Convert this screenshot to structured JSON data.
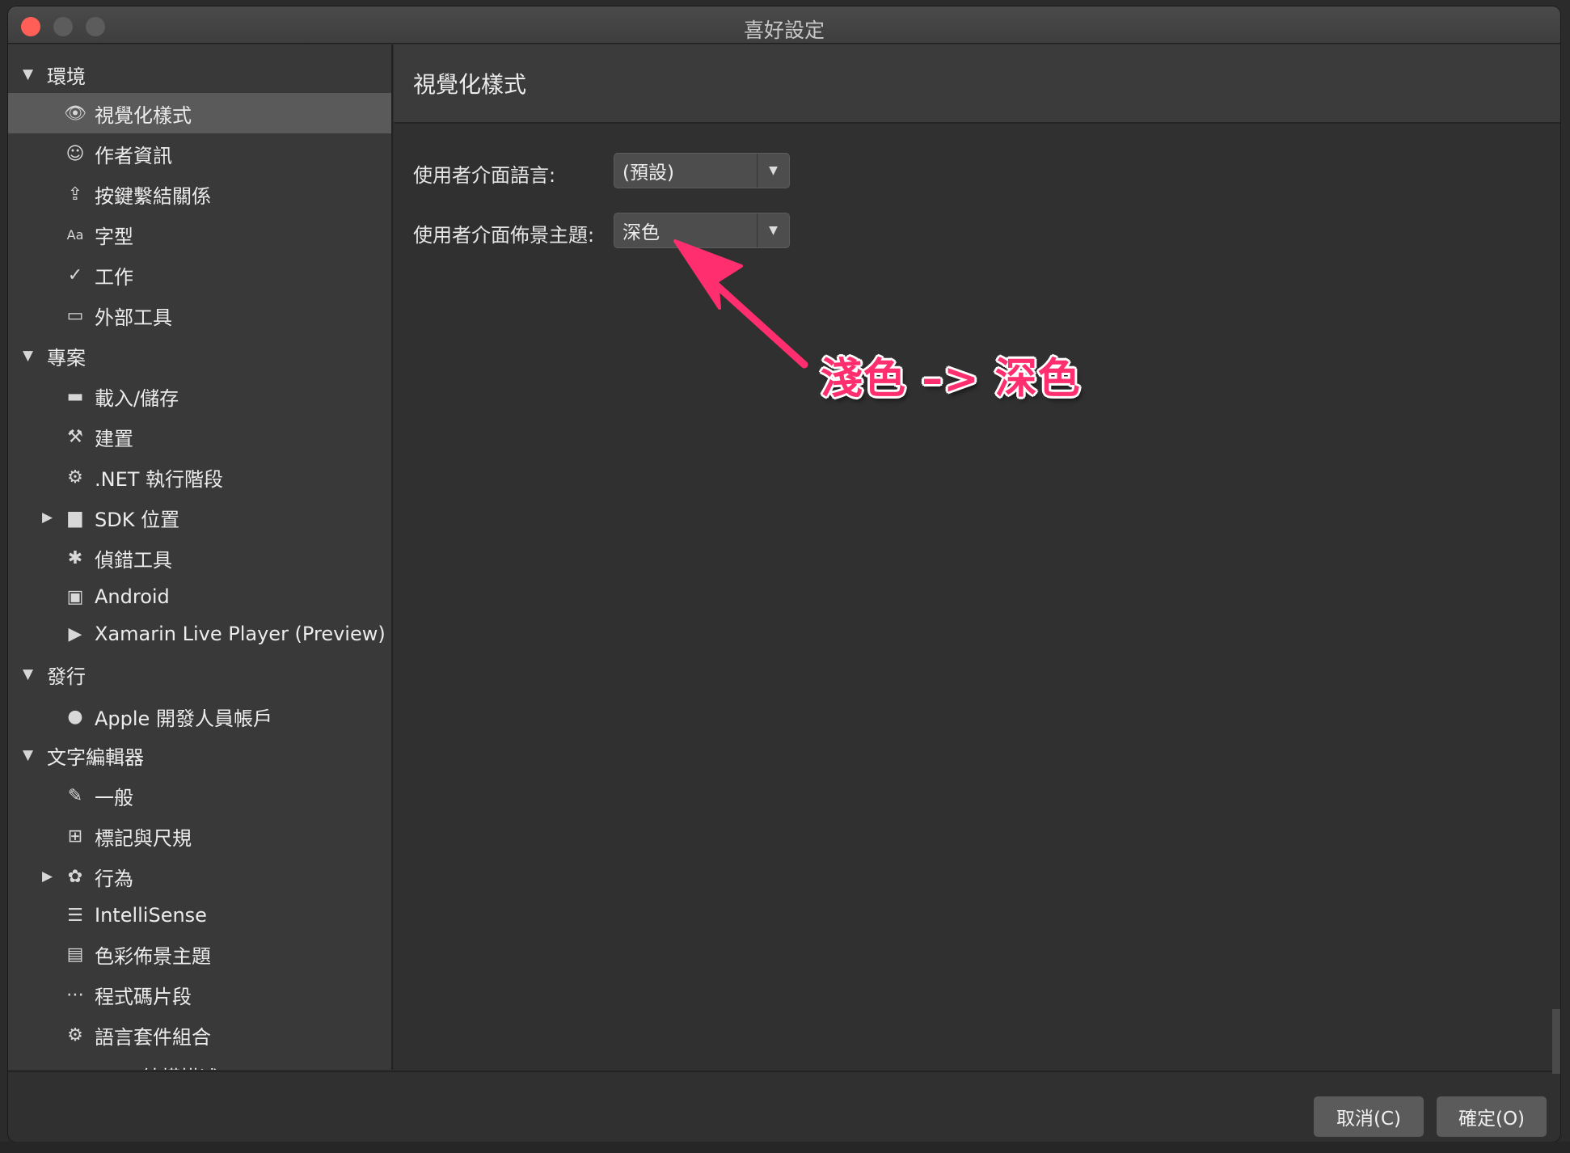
{
  "window": {
    "title": "喜好設定"
  },
  "sidebar": {
    "items": [
      {
        "type": "section",
        "label": "環境",
        "expanded": true,
        "icon": "triangle-down"
      },
      {
        "type": "item",
        "label": "視覺化樣式",
        "icon": "eye-icon",
        "selected": true
      },
      {
        "type": "item",
        "label": "作者資訊",
        "icon": "smiley-icon"
      },
      {
        "type": "item",
        "label": "按鍵繫結關係",
        "icon": "keyboard-icon"
      },
      {
        "type": "item",
        "label": "字型",
        "icon": "font-icon",
        "glyph": "Aa"
      },
      {
        "type": "item",
        "label": "工作",
        "icon": "checkmark-icon"
      },
      {
        "type": "item",
        "label": "外部工具",
        "icon": "terminal-icon"
      },
      {
        "type": "section",
        "label": "專案",
        "expanded": true,
        "icon": "triangle-down"
      },
      {
        "type": "item",
        "label": "載入/儲存",
        "icon": "disk-icon"
      },
      {
        "type": "item",
        "label": "建置",
        "icon": "hammer-icon"
      },
      {
        "type": "item",
        "label": ".NET 執行階段",
        "icon": "gear-icon"
      },
      {
        "type": "item",
        "label": "SDK 位置",
        "icon": "folder-icon",
        "collapsible": true
      },
      {
        "type": "item",
        "label": "偵錯工具",
        "icon": "bug-icon"
      },
      {
        "type": "item",
        "label": "Android",
        "icon": "android-icon"
      },
      {
        "type": "item",
        "label": "Xamarin Live Player (Preview)",
        "icon": "play-icon"
      },
      {
        "type": "section",
        "label": "發行",
        "expanded": true,
        "icon": "triangle-down"
      },
      {
        "type": "item",
        "label": "Apple 開發人員帳戶",
        "icon": "apple-icon"
      },
      {
        "type": "section",
        "label": "文字編輯器",
        "expanded": true,
        "icon": "triangle-down"
      },
      {
        "type": "item",
        "label": "一般",
        "icon": "edit-icon"
      },
      {
        "type": "item",
        "label": "標記與尺規",
        "icon": "grid-icon"
      },
      {
        "type": "item",
        "label": "行為",
        "icon": "brain-icon",
        "collapsible": true
      },
      {
        "type": "item",
        "label": "IntelliSense",
        "icon": "list-icon"
      },
      {
        "type": "item",
        "label": "色彩佈景主題",
        "icon": "document-icon"
      },
      {
        "type": "item",
        "label": "程式碼片段",
        "icon": "snippet-icon"
      },
      {
        "type": "item",
        "label": "語言套件組合",
        "icon": "gear-icon"
      },
      {
        "type": "item",
        "label": "XML 結構描述",
        "icon": "xml-icon"
      }
    ]
  },
  "content": {
    "title": "視覺化樣式",
    "language": {
      "label": "使用者介面語言:",
      "value": "(預設)"
    },
    "theme": {
      "label": "使用者介面佈景主題:",
      "value": "深色"
    }
  },
  "annotation": {
    "text": "淺色 –> 深色",
    "color": "#ff2e6f"
  },
  "footer": {
    "cancel_label": "取消(C)",
    "ok_label": "確定(O)"
  }
}
